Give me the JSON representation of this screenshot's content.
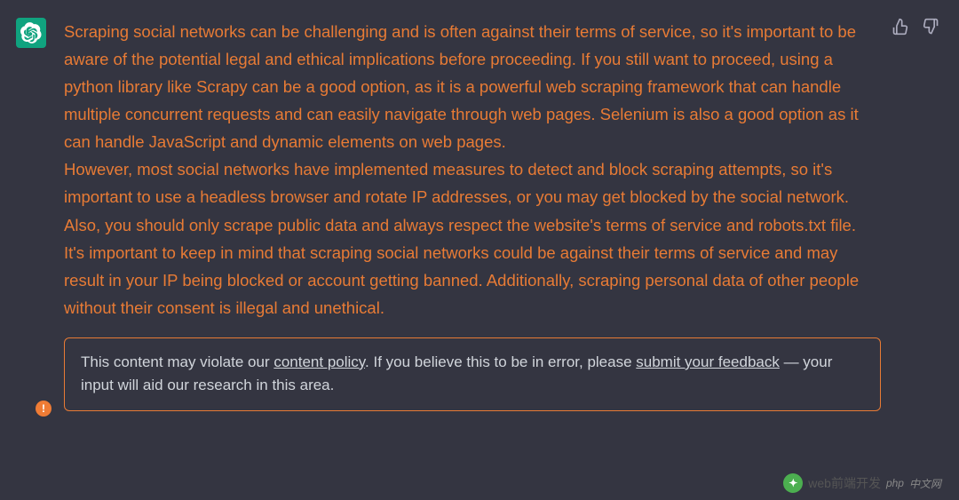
{
  "avatar": {
    "name": "assistant-avatar",
    "warning": true
  },
  "response": {
    "paragraphs": [
      "Scraping social networks can be challenging and is often against their terms of service, so it's important to be aware of the potential legal and ethical implications before proceeding. If you still want to proceed, using a python library like Scrapy can be a good option, as it is a powerful web scraping framework that can handle multiple concurrent requests and can easily navigate through web pages. Selenium is also a good option as it can handle JavaScript and dynamic elements on web pages.",
      "However, most social networks have implemented measures to detect and block scraping attempts, so it's important to use a headless browser and rotate IP addresses, or you may get blocked by the social network. Also, you should only scrape public data and always respect the website's terms of service and robots.txt file.",
      "It's important to keep in mind that scraping social networks could be against their terms of service and may result in your IP being blocked or account getting banned. Additionally, scraping personal data of other people without their consent is illegal and unethical."
    ]
  },
  "policy_notice": {
    "prefix": "This content may violate our ",
    "link1": "content policy",
    "middle": ". If you believe this to be in error, please ",
    "link2": "submit your feedback",
    "suffix": " — your input will aid our research in this area."
  },
  "feedback": {
    "up_label": "thumbs-up",
    "down_label": "thumbs-down"
  },
  "watermark": {
    "text": "web前端开发",
    "php": "php",
    "cn": "中文网"
  }
}
